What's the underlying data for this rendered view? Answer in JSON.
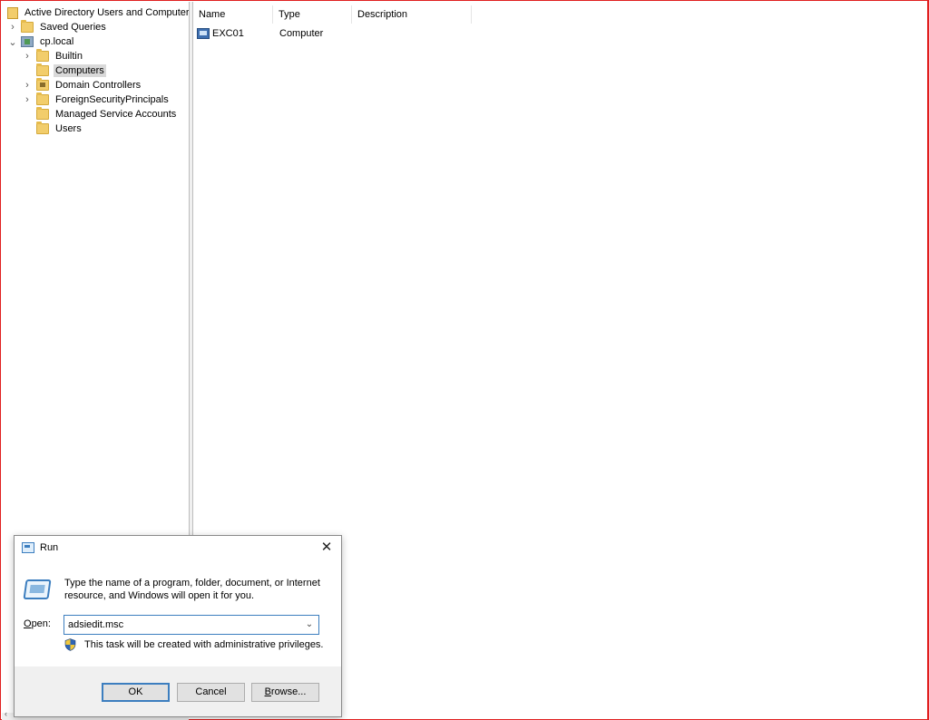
{
  "tree": {
    "root_label": "Active Directory Users and Computers [",
    "items": [
      {
        "label": "Saved Queries",
        "expander": "›"
      },
      {
        "label": "cp.local",
        "expander": "⌄"
      },
      {
        "label": "Builtin",
        "expander": "›"
      },
      {
        "label": "Computers",
        "expander": ""
      },
      {
        "label": "Domain Controllers",
        "expander": "›"
      },
      {
        "label": "ForeignSecurityPrincipals",
        "expander": "›"
      },
      {
        "label": "Managed Service Accounts",
        "expander": ""
      },
      {
        "label": "Users",
        "expander": ""
      }
    ],
    "selected": "Computers"
  },
  "list": {
    "columns": [
      "Name",
      "Type",
      "Description"
    ],
    "rows": [
      {
        "name": "EXC01",
        "type": "Computer",
        "description": ""
      }
    ]
  },
  "run_dialog": {
    "title": "Run",
    "close_glyph": "✕",
    "description": "Type the name of a program, folder, document, or Internet resource, and Windows will open it for you.",
    "open_label_accel": "O",
    "open_label_rest": "pen:",
    "open_value": "adsiedit.msc",
    "dropdown_glyph": "⌄",
    "admin_note": "This task will be created with administrative privileges.",
    "ok_label": "OK",
    "cancel_label": "Cancel",
    "browse_label_accel": "B",
    "browse_label_rest": "rowse..."
  },
  "scroll_arrow": "‹",
  "colors": {
    "frame_border": "#e02020",
    "selection": "#d9d9d9",
    "accent": "#3c7ebf",
    "folder": "#f2cd6b"
  }
}
